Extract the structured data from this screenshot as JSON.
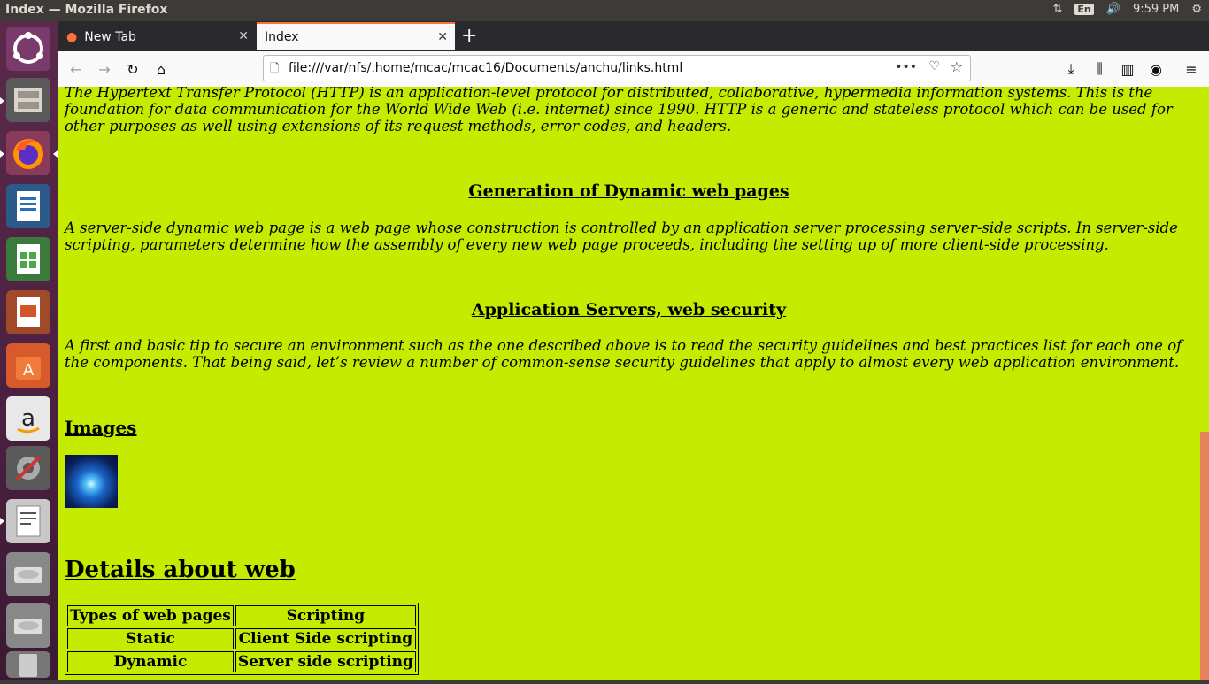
{
  "window": {
    "title": "Index — Mozilla Firefox",
    "language": "En",
    "clock": "9:59 PM"
  },
  "launcher": {
    "items": [
      "ubuntu-logo-icon",
      "files-icon",
      "firefox-icon",
      "writer-icon",
      "calc-icon",
      "impress-icon",
      "software-center-icon",
      "amazon-icon",
      "system-settings-icon",
      "text-editor-icon",
      "drive-icon",
      "drive-icon",
      "trash-icon"
    ]
  },
  "tabs": [
    {
      "label": "New Tab",
      "active": false
    },
    {
      "label": "Index",
      "active": true
    }
  ],
  "toolbar": {
    "url": "file:///var/nfs/.home/mcac/mcac16/Documents/anchu/links.html",
    "more": "•••"
  },
  "content": {
    "http_para": "The Hypertext Transfer Protocol (HTTP) is an application-level protocol for distributed, collaborative, hypermedia information systems. This is the foundation for data communication for the World Wide Web (i.e. internet) since 1990. HTTP is a generic and stateless protocol which can be used for other purposes as well using extensions of its request methods, error codes, and headers.",
    "dynamic_heading": "Generation of Dynamic web pages",
    "dynamic_para": "A server-side dynamic web page is a web page whose construction is controlled by an application server processing server-side scripts. In server-side scripting, parameters determine how the assembly of every new web page proceeds, including the setting up of more client-side processing.",
    "security_heading": "Application Servers, web security",
    "security_para": "A first and basic tip to secure an environment such as the one described above is to read the security guidelines and best practices list for each one of the components. That being said, let’s review a number of common-sense security guidelines that apply to almost every web application environment.",
    "images_heading": "Images",
    "details_heading": "Details about web",
    "table": {
      "headers": [
        "Types of web pages",
        "Scripting"
      ],
      "rows": [
        [
          "Static",
          "Client Side scripting"
        ],
        [
          "Dynamic",
          "Server side scripting"
        ]
      ]
    }
  }
}
